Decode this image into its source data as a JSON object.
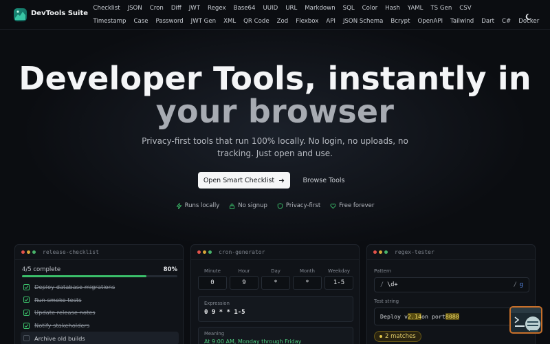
{
  "brand": {
    "name": "DevTools Suite"
  },
  "nav": {
    "row1": [
      "Checklist",
      "JSON",
      "Cron",
      "Diff",
      "JWT",
      "Regex",
      "Base64",
      "UUID",
      "URL",
      "Markdown",
      "SQL",
      "Color",
      "Hash",
      "YAML",
      "TS Gen",
      "CSV"
    ],
    "row2": [
      "Timestamp",
      "Case",
      "Password",
      "JWT Gen",
      "XML",
      "QR Code",
      "Zod",
      "Flexbox",
      "API",
      "JSON Schema",
      "Bcrypt",
      "OpenAPI",
      "Tailwind",
      "Dart",
      "C#",
      "Docker"
    ]
  },
  "hero": {
    "title_line1": "Developer Tools, instantly in",
    "title_line2": "your browser",
    "subtitle": "Privacy-first tools that run 100% locally. No login, no uploads, no tracking. Just open and use.",
    "primary_cta": "Open Smart Checklist",
    "secondary_cta": "Browse Tools",
    "features": [
      "Runs locally",
      "No signup",
      "Privacy-first",
      "Free forever"
    ]
  },
  "checklist_card": {
    "title": "release-checklist",
    "progress_text": "4/5 complete",
    "progress_pct": "80%",
    "progress_value": 0.8,
    "items": [
      {
        "label": "Deploy database migrations",
        "done": true
      },
      {
        "label": "Run smoke tests",
        "done": true
      },
      {
        "label": "Update release notes",
        "done": true
      },
      {
        "label": "Notify stakeholders",
        "done": true
      },
      {
        "label": "Archive old builds",
        "done": false
      }
    ]
  },
  "cron_card": {
    "title": "cron-generator",
    "labels": [
      "Minute",
      "Hour",
      "Day",
      "Month",
      "Weekday"
    ],
    "values": [
      "0",
      "9",
      "*",
      "*",
      "1-5"
    ],
    "expression_label": "Expression",
    "expression": "0 9 * * 1-5",
    "meaning_label": "Meaning",
    "meaning": "At 9:00 AM, Monday through Friday"
  },
  "regex_card": {
    "title": "regex-tester",
    "pattern_label": "Pattern",
    "pattern_open": "/",
    "pattern": "\\d+",
    "pattern_close": "/",
    "flag": "g",
    "test_label": "Test string",
    "test_pre": "Deploy v",
    "match1": "2.14",
    "test_mid": " on port ",
    "match2": "8080",
    "matches": "2 matches"
  },
  "colors": {
    "accent_green": "#3bbf6a",
    "match_yellow": "#e4cf6a",
    "background": "#0b0d11"
  }
}
